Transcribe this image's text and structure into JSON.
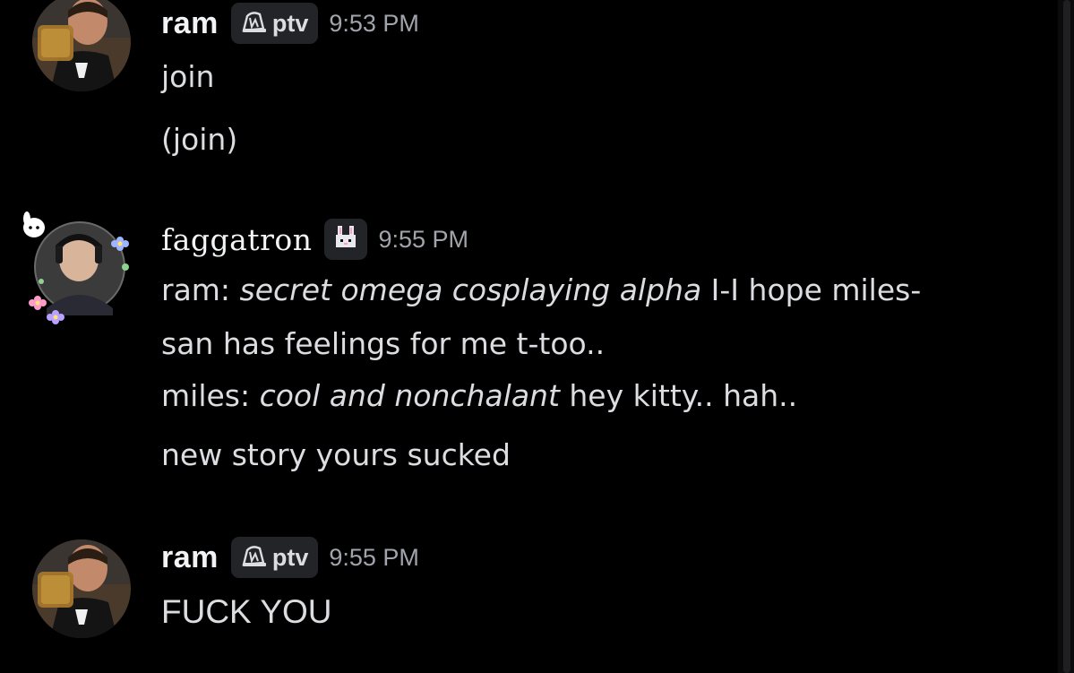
{
  "messages": [
    {
      "author": "ram",
      "tag": "ptv",
      "tag_icon": "emblem-icon",
      "time": "9:53 PM",
      "lines": [
        "join",
        "(join)"
      ]
    },
    {
      "author": "faggatron",
      "tag_icon": "bunny-icon",
      "time": "9:55 PM",
      "line1": {
        "a": "ram: ",
        "b": "secret omega cosplaying alpha",
        "c": " I-I hope miles-"
      },
      "line2": "san has feelings for me t-too..",
      "line3": {
        "a": "miles: ",
        "b": "cool and nonchalant",
        "c": " hey kitty.. hah.."
      },
      "line4": "new story yours sucked"
    },
    {
      "author": "ram",
      "tag": "ptv",
      "tag_icon": "emblem-icon",
      "time": "9:55 PM",
      "lines": [
        "FUCK YOU"
      ]
    }
  ],
  "colors": {
    "background": "#000000",
    "username": "#f2f3f5",
    "message_text": "#dcdde1",
    "timestamp": "#a2a4ab",
    "tag_bg": "#232428"
  }
}
